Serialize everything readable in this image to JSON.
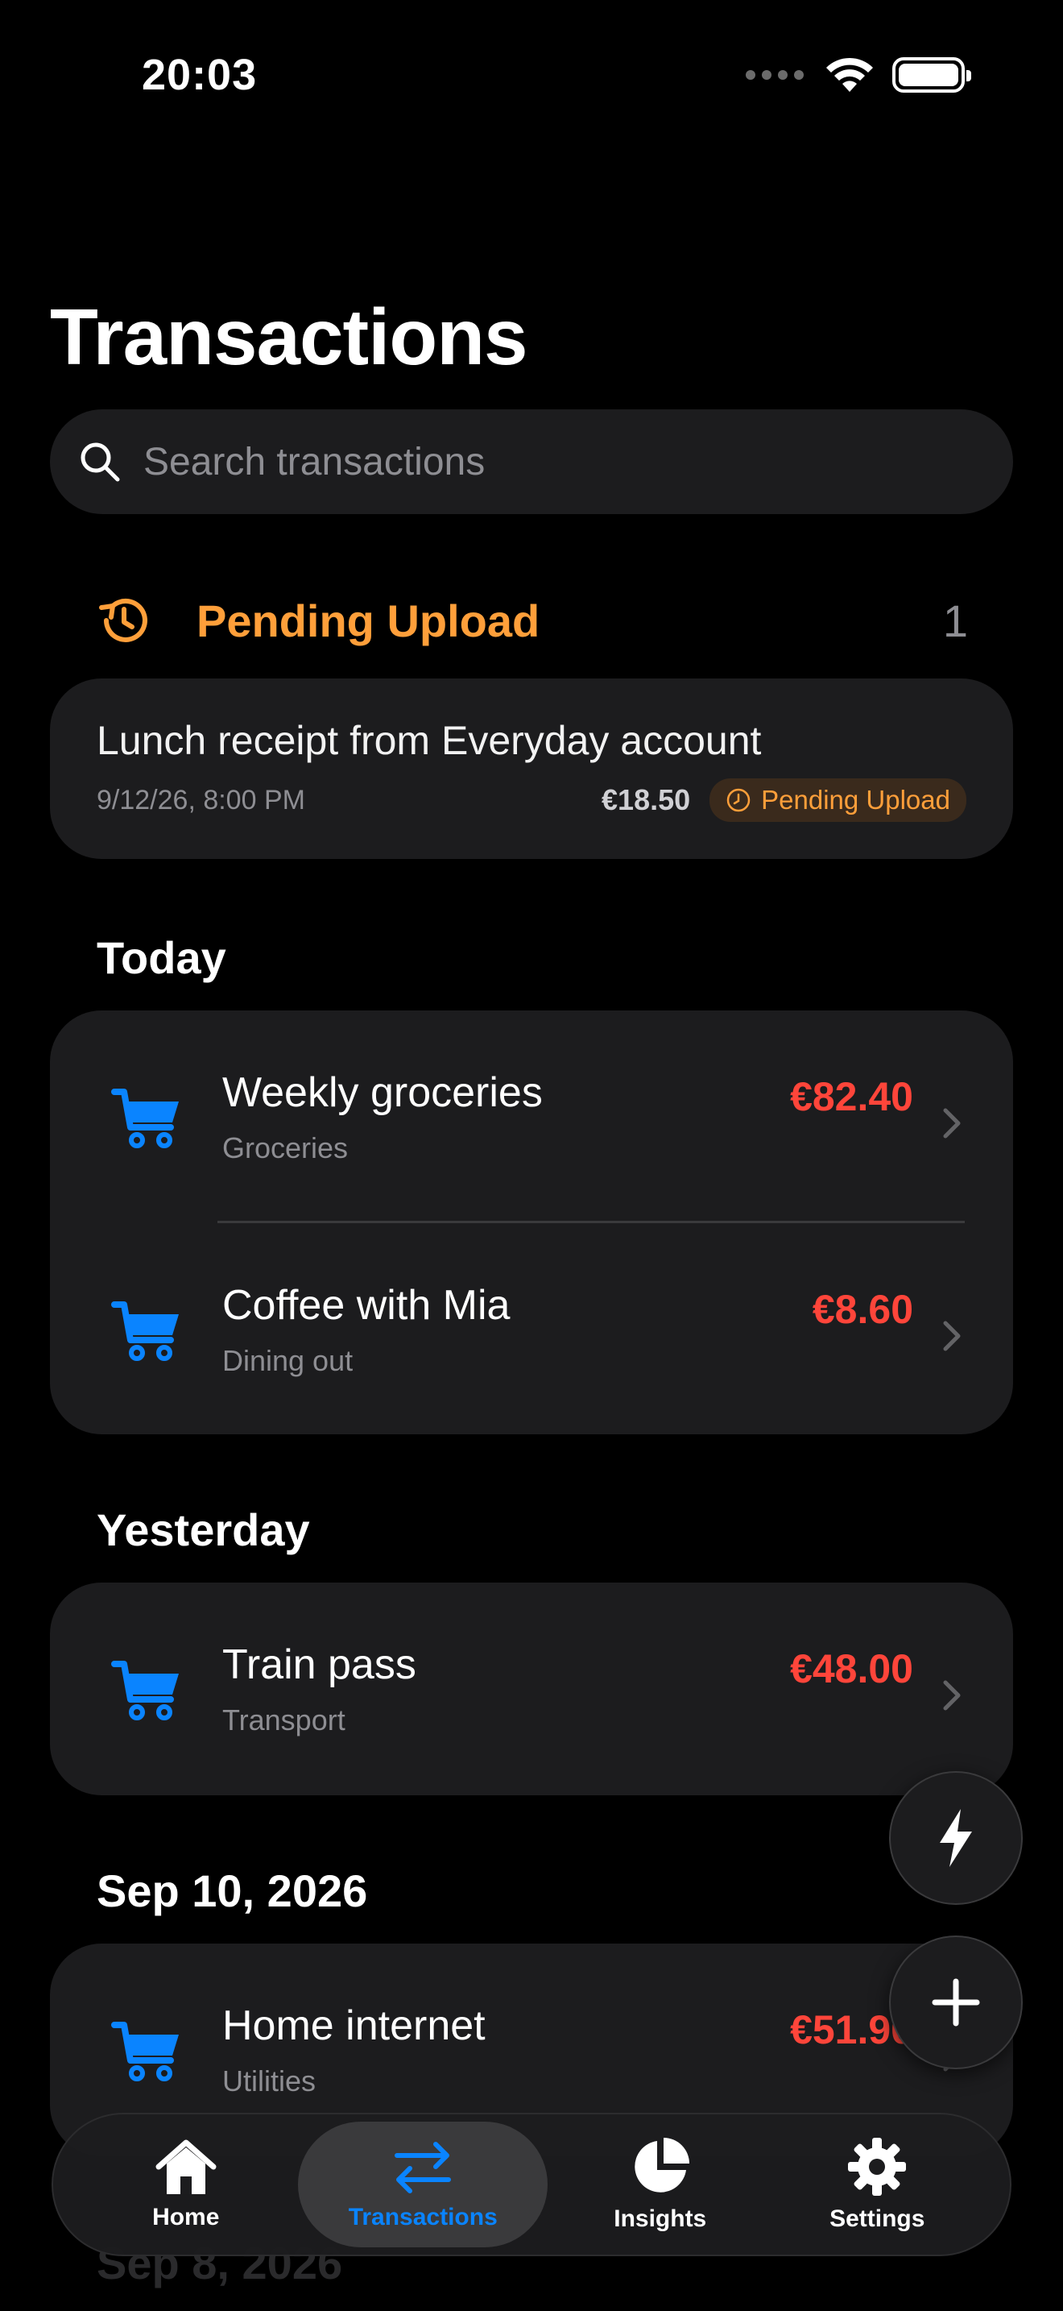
{
  "status_bar": {
    "time": "20:03"
  },
  "page": {
    "title": "Transactions"
  },
  "search": {
    "placeholder": "Search transactions"
  },
  "pending": {
    "title": "Pending Upload",
    "count": "1",
    "item": {
      "title": "Lunch receipt from Everyday account",
      "date": "9/12/26, 8:00 PM",
      "amount": "€18.50",
      "badge": "Pending Upload"
    }
  },
  "sections": [
    {
      "heading": "Today",
      "items": [
        {
          "name": "Weekly groceries",
          "category": "Groceries",
          "amount": "€82.40"
        },
        {
          "name": "Coffee with Mia",
          "category": "Dining out",
          "amount": "€8.60"
        }
      ]
    },
    {
      "heading": "Yesterday",
      "items": [
        {
          "name": "Train pass",
          "category": "Transport",
          "amount": "€48.00"
        }
      ]
    },
    {
      "heading": "Sep 10, 2026",
      "items": [
        {
          "name": "Home internet",
          "category": "Utilities",
          "amount": "€51.90"
        }
      ]
    },
    {
      "heading": "Sep 8, 2026"
    }
  ],
  "tabs": [
    {
      "label": "Home"
    },
    {
      "label": "Transactions"
    },
    {
      "label": "Insights"
    },
    {
      "label": "Settings"
    }
  ],
  "colors": {
    "accent": "#0a84ff",
    "expense": "#ff453a",
    "pending": "#ff9f3a",
    "card": "#1c1c1e"
  }
}
